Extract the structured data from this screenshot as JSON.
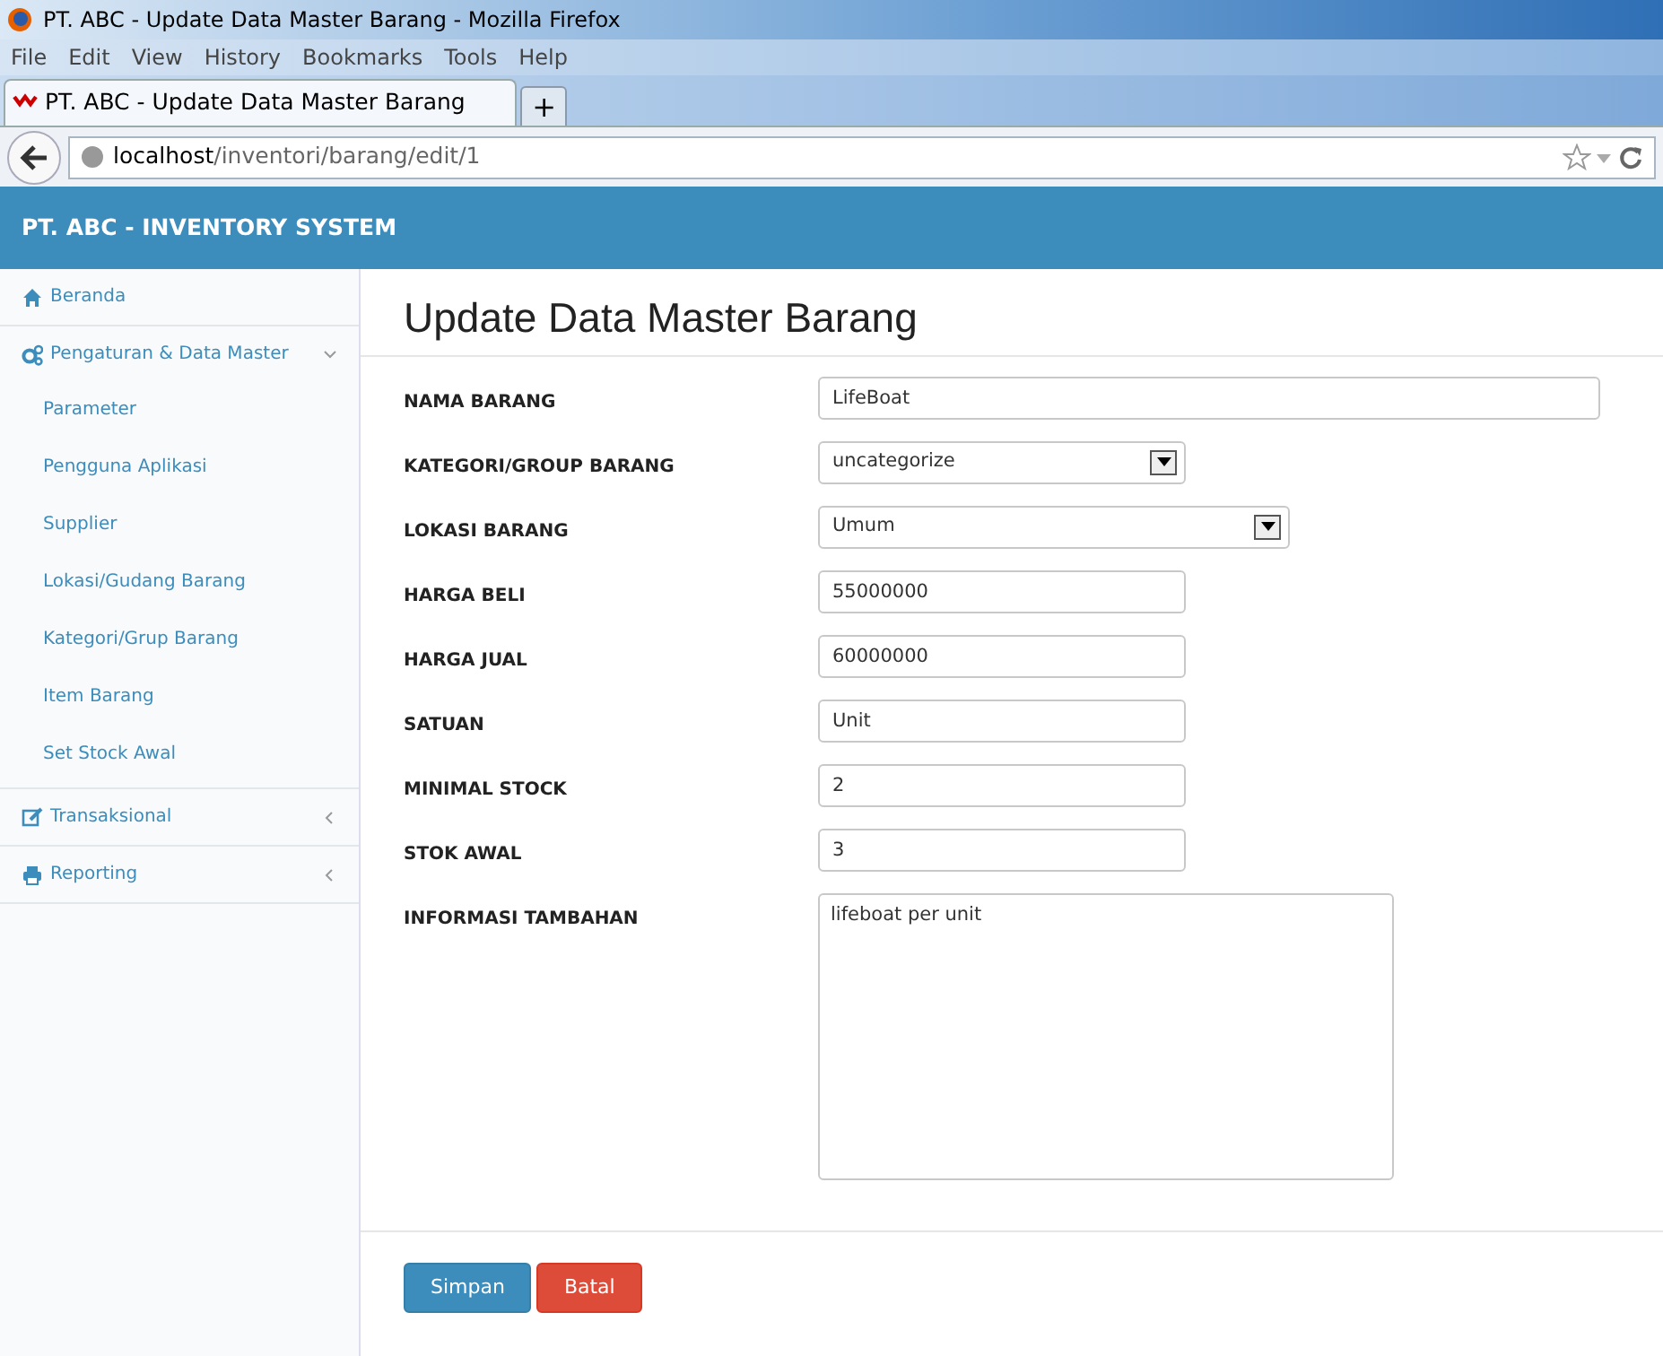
{
  "window": {
    "title": "PT. ABC - Update Data Master Barang - Mozilla Firefox"
  },
  "menu": [
    "File",
    "Edit",
    "View",
    "History",
    "Bookmarks",
    "Tools",
    "Help"
  ],
  "tabs": [
    {
      "label": "PT. ABC - Update Data Master Barang",
      "selected": true
    }
  ],
  "new_tab": "+",
  "address_bar": {
    "host": "localhost",
    "path": "/inventori/barang/edit/1"
  },
  "app_header": {
    "title": "PT. ABC - INVENTORY SYSTEM"
  },
  "sidebar": {
    "items": [
      {
        "label": "Beranda"
      },
      {
        "label": "Pengaturan & Data Master",
        "expanded": true,
        "children": [
          {
            "label": "Parameter"
          },
          {
            "label": "Pengguna Aplikasi"
          },
          {
            "label": "Supplier"
          },
          {
            "label": "Lokasi/Gudang Barang"
          },
          {
            "label": "Kategori/Grup Barang"
          },
          {
            "label": "Item Barang"
          },
          {
            "label": "Set Stock Awal"
          }
        ]
      },
      {
        "label": "Transaksional",
        "expanded": false
      },
      {
        "label": "Reporting",
        "expanded": false
      }
    ]
  },
  "page_title": "Update Data Master Barang",
  "form": [
    {
      "label": "NAMA BARANG",
      "kind": "text",
      "value": "LifeBoat"
    },
    {
      "label": "KATEGORI/GROUP BARANG",
      "kind": "select",
      "value": "uncategorize"
    },
    {
      "label": "LOKASI BARANG",
      "kind": "select",
      "value": "Umum"
    },
    {
      "label": "HARGA BELI",
      "kind": "text",
      "value": "55000000"
    },
    {
      "label": "HARGA JUAL",
      "kind": "text",
      "value": "60000000"
    },
    {
      "label": "SATUAN",
      "kind": "text",
      "value": "Unit"
    },
    {
      "label": "MINIMAL STOCK",
      "kind": "text",
      "value": "2"
    },
    {
      "label": "STOK AWAL",
      "kind": "text",
      "value": "3"
    },
    {
      "label": "INFORMASI TAMBAHAN",
      "kind": "textarea",
      "value": "lifeboat per unit"
    }
  ],
  "buttons": [
    {
      "label": "Simpan",
      "kind": "primary"
    },
    {
      "label": "Batal",
      "kind": "danger"
    }
  ]
}
